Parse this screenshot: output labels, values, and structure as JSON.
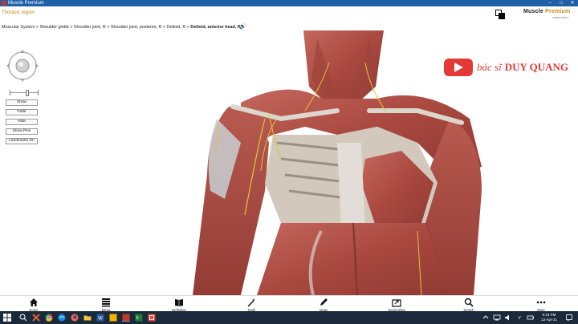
{
  "window": {
    "title": "Muscle Premium",
    "min": "–",
    "max": "□",
    "close": "✕"
  },
  "header": {
    "region": "Thoracic region",
    "brand_main": "Muscle ",
    "brand_accent": "Premium",
    "brand_sub": "VISIBLE BODY",
    "layer_icon": "layers-icon"
  },
  "breadcrumb": {
    "path": "Muscular System > Shoulder girdle > Shoulder joint, R > Shoulder joint, posterior, R > Deltoid, R > ",
    "current": "Deltoid, anterior head, R",
    "speaker_icon": "speaker-icon",
    "speaker_glyph": "🔊"
  },
  "watermark": {
    "prefix": "bác sĩ",
    "name": "DUY QUANG"
  },
  "side_panel": {
    "buttons": [
      "Show",
      "Fade",
      "Hide",
      "Show Pins",
      "Landmarks On"
    ]
  },
  "toolbar": {
    "items": [
      {
        "label": "Home",
        "icon": "home-icon"
      },
      {
        "label": "Menu",
        "icon": "menu-icon"
      },
      {
        "label": "Definition",
        "icon": "book-icon"
      },
      {
        "label": "Tools",
        "icon": "wand-icon"
      },
      {
        "label": "Draw",
        "icon": "pencil-icon"
      },
      {
        "label": "Screenshot",
        "icon": "screenshot-icon"
      },
      {
        "label": "Search",
        "icon": "search-icon"
      },
      {
        "label": "More",
        "icon": "more-icon"
      }
    ]
  },
  "taskbar": {
    "time": "9:23 PM",
    "date": "13-Apr-21"
  },
  "colors": {
    "accent": "#c58a1a",
    "titlebar": "#1f5fa8",
    "taskbar": "#1b2a3a",
    "watermark": "#e53935",
    "muscle": "#b5544a"
  }
}
